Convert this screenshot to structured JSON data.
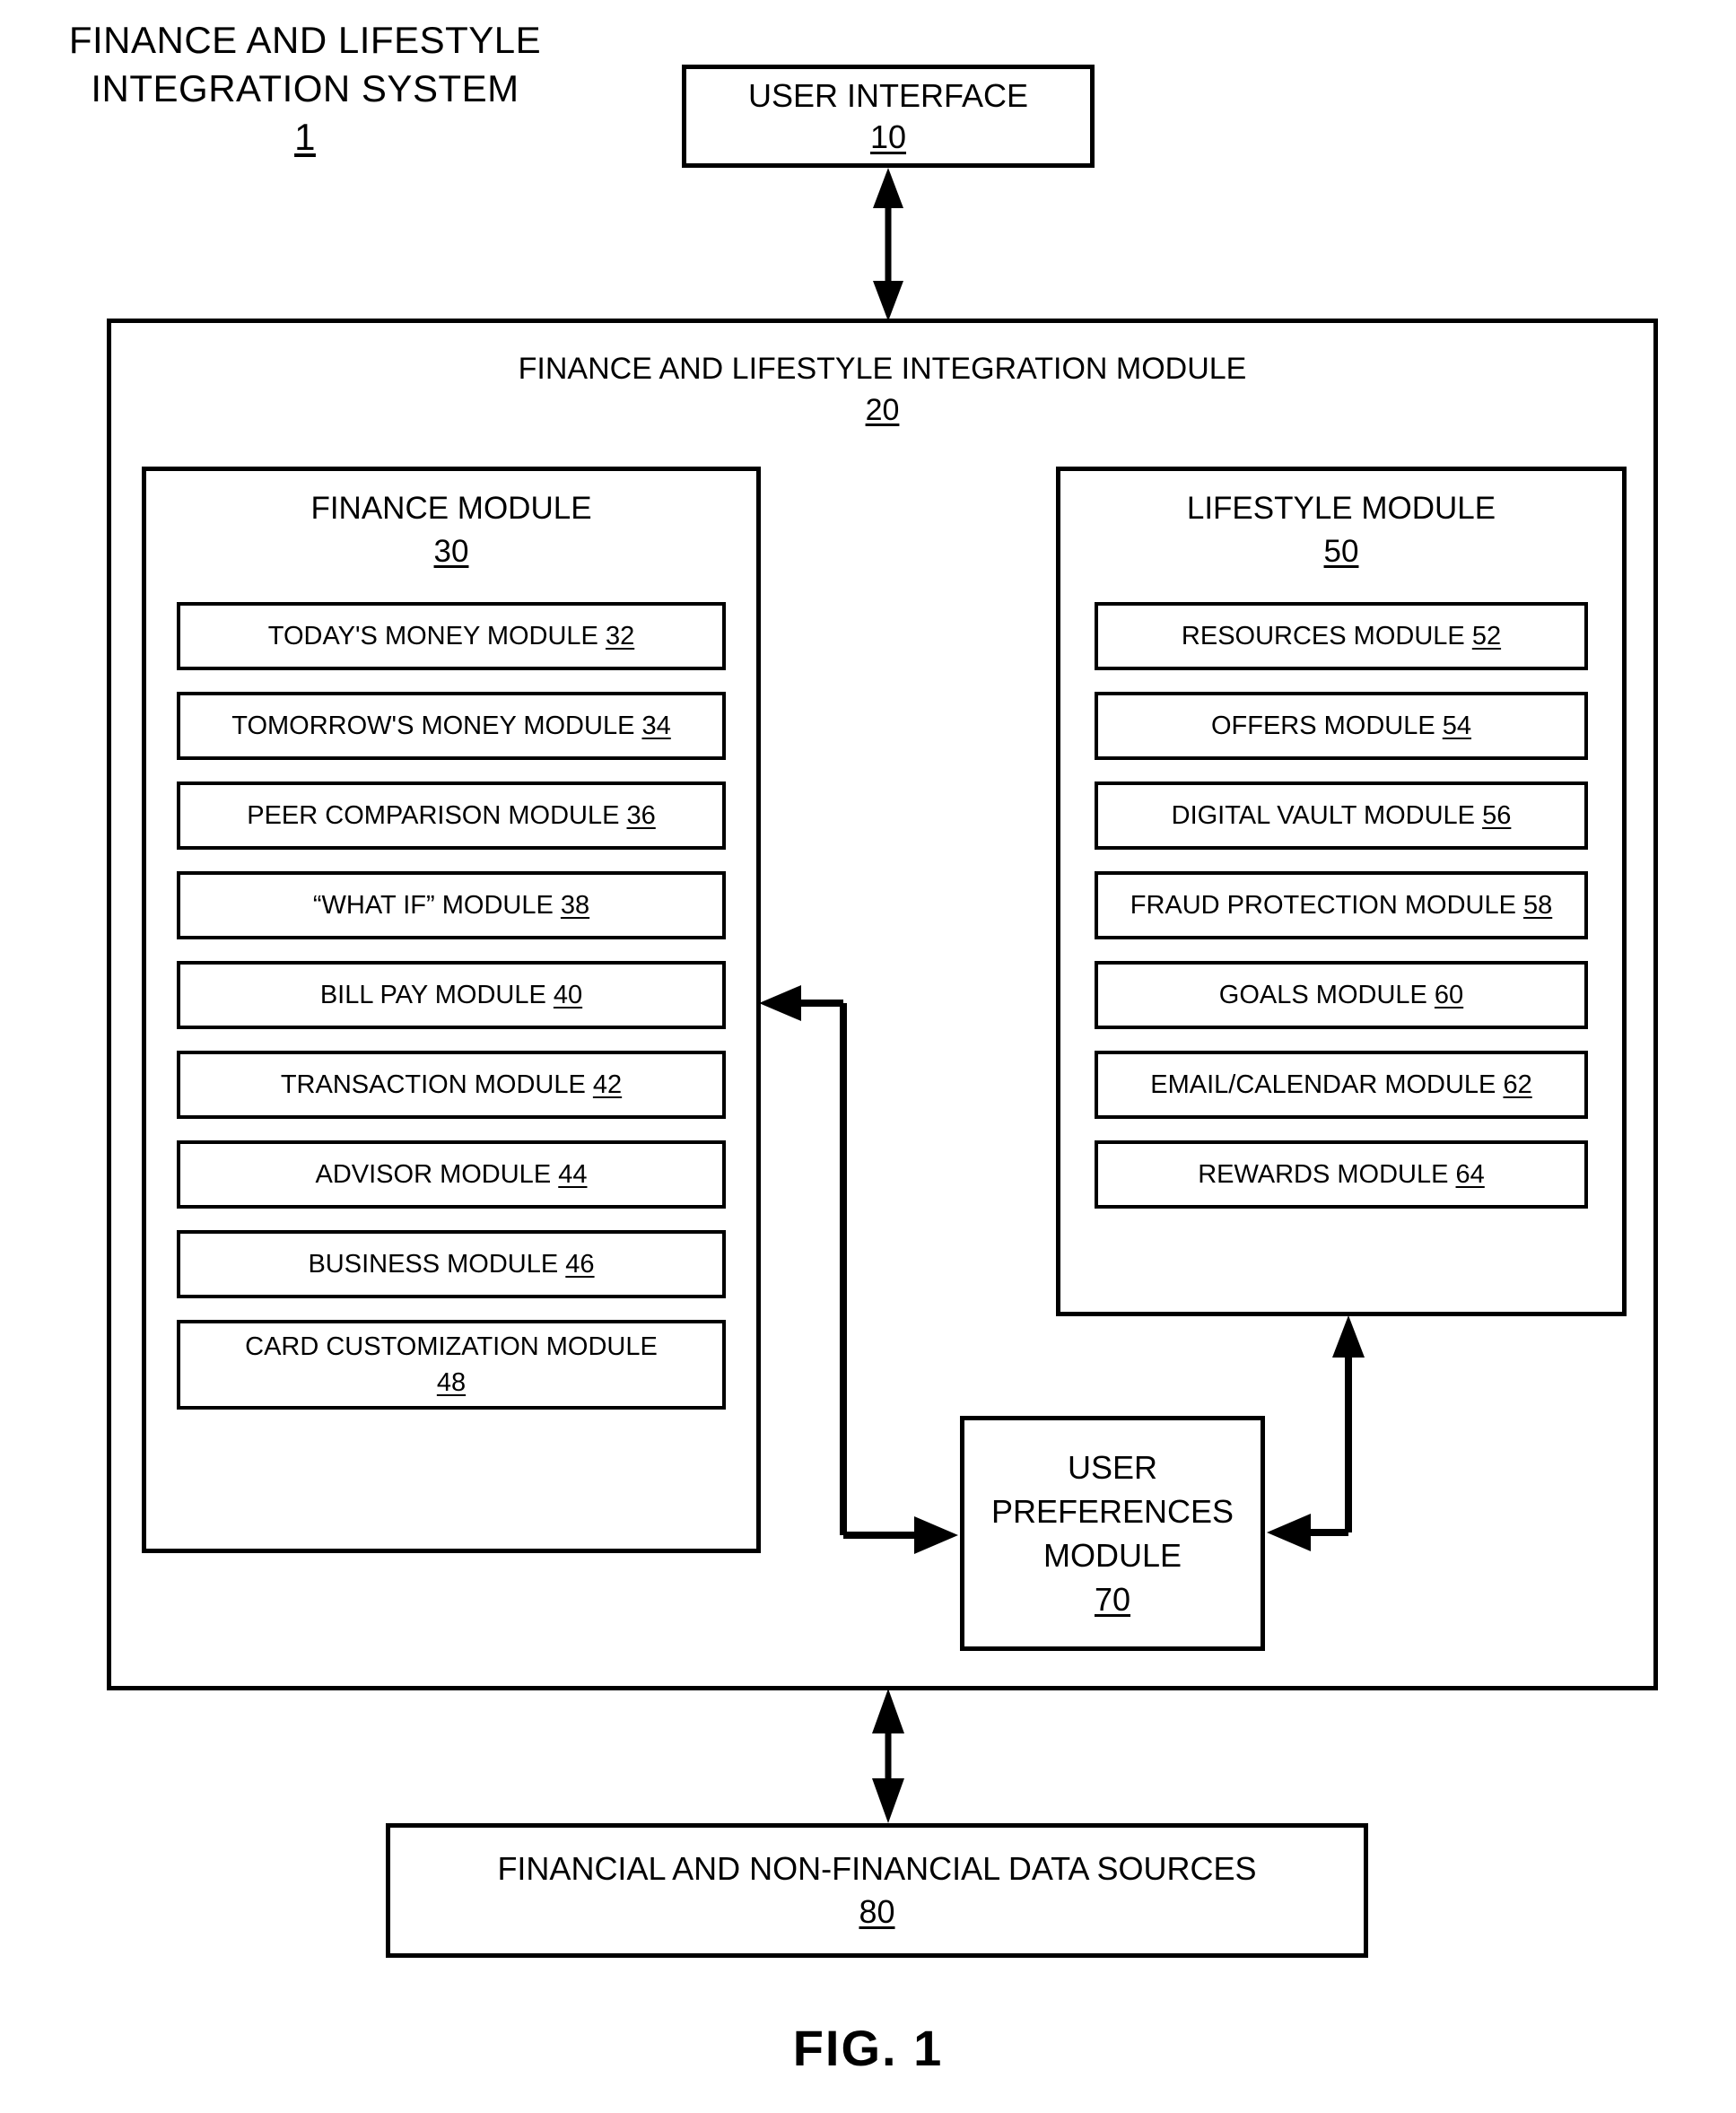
{
  "figure": {
    "system_title_line1": "FINANCE AND LIFESTYLE",
    "system_title_line2": "INTEGRATION SYSTEM",
    "system_ref": "1",
    "caption": "FIG. 1"
  },
  "user_interface": {
    "label": "USER INTERFACE",
    "ref": "10"
  },
  "integration_module": {
    "label": "FINANCE AND LIFESTYLE INTEGRATION MODULE",
    "ref": "20"
  },
  "finance_module": {
    "label": "FINANCE MODULE",
    "ref": "30",
    "items": [
      {
        "label": "TODAY'S MONEY MODULE",
        "ref": "32"
      },
      {
        "label": "TOMORROW'S MONEY MODULE",
        "ref": "34"
      },
      {
        "label": "PEER COMPARISON MODULE",
        "ref": "36"
      },
      {
        "label": "“WHAT IF” MODULE",
        "ref": "38"
      },
      {
        "label": "BILL PAY MODULE",
        "ref": "40"
      },
      {
        "label": "TRANSACTION MODULE",
        "ref": "42"
      },
      {
        "label": "ADVISOR MODULE",
        "ref": "44"
      },
      {
        "label": "BUSINESS MODULE",
        "ref": "46"
      },
      {
        "label": "CARD CUSTOMIZATION MODULE",
        "ref": "48"
      }
    ]
  },
  "lifestyle_module": {
    "label": "LIFESTYLE MODULE",
    "ref": "50",
    "items": [
      {
        "label": "RESOURCES MODULE",
        "ref": "52"
      },
      {
        "label": "OFFERS MODULE",
        "ref": "54"
      },
      {
        "label": "DIGITAL VAULT MODULE",
        "ref": "56"
      },
      {
        "label": "FRAUD PROTECTION MODULE",
        "ref": "58"
      },
      {
        "label": "GOALS MODULE",
        "ref": "60"
      },
      {
        "label": "EMAIL/CALENDAR MODULE",
        "ref": "62"
      },
      {
        "label": "REWARDS MODULE",
        "ref": "64"
      }
    ]
  },
  "user_preferences_module": {
    "line1": "USER",
    "line2": "PREFERENCES",
    "line3": "MODULE",
    "ref": "70"
  },
  "data_sources": {
    "label": "FINANCIAL AND NON-FINANCIAL DATA SOURCES",
    "ref": "80"
  },
  "colors": {
    "stroke": "#000000",
    "background": "#ffffff"
  }
}
